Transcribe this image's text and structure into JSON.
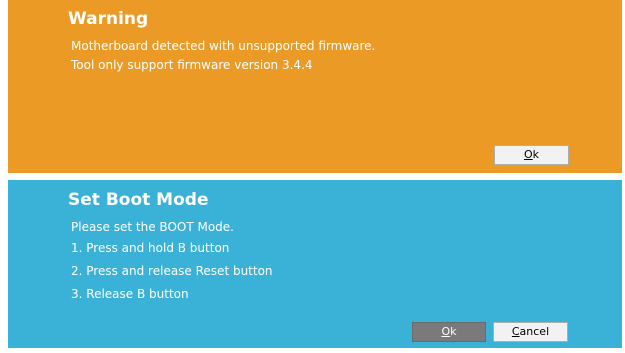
{
  "warning_dialog": {
    "title": "Warning",
    "lines": [
      "Motherboard detected with unsupported firmware.",
      "Tool only support firmware version 3.4.4"
    ],
    "ok_button": {
      "mnemonic": "O",
      "rest": "k"
    },
    "colors": {
      "background": "#eb9a26",
      "text": "#ffffff"
    }
  },
  "boot_mode_dialog": {
    "title": "Set Boot Mode",
    "lines": [
      "Please set the BOOT Mode.",
      "1. Press and hold B button",
      "2. Press and release Reset button",
      "3. Release B button"
    ],
    "ok_button": {
      "mnemonic": "O",
      "rest": "k"
    },
    "cancel_button": {
      "mnemonic": "C",
      "rest": "ancel"
    },
    "colors": {
      "background": "#3ab2d8",
      "text": "#ffffff",
      "ok_button_background": "#7a7a7a"
    }
  }
}
